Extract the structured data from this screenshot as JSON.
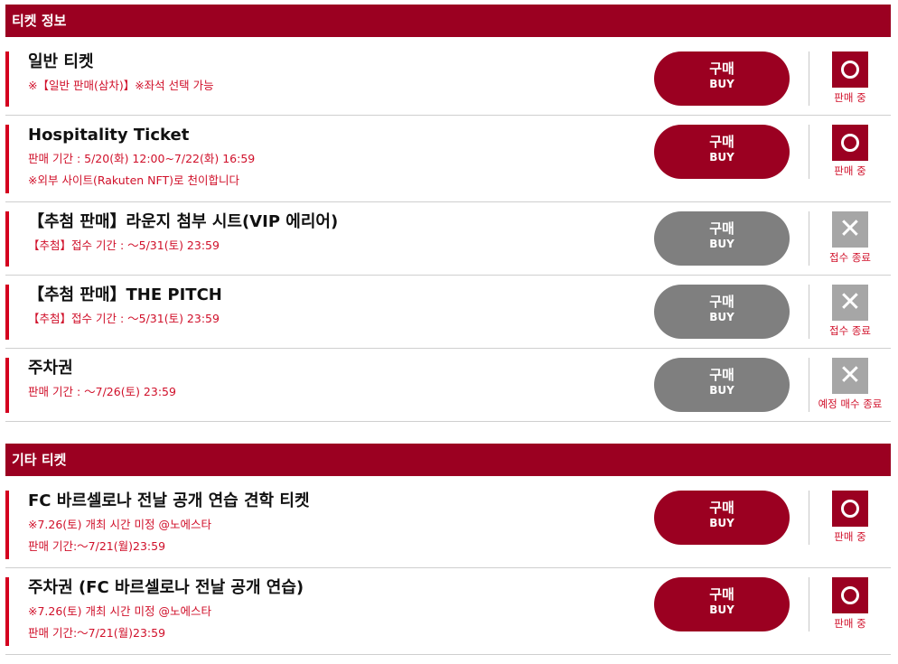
{
  "sections": [
    {
      "title": "티켓 정보"
    },
    {
      "title": "기타 티켓"
    }
  ],
  "buy": {
    "ko": "구매",
    "en": "BUY"
  },
  "rows": [
    {
      "title": "일반 티켓",
      "notes": [
        "※【일반 판매(삼차)】※좌석 선택 가능"
      ],
      "status": "판매 중"
    },
    {
      "title": "Hospitality Ticket",
      "notes": [
        "판매 기간 : 5/20(화) 12:00~7/22(화) 16:59",
        "※외부 사이트(Rakuten NFT)로 천이합니다"
      ],
      "status": "판매 중"
    },
    {
      "title": "【추첨 판매】라운지 첨부 시트(VIP 에리어)",
      "notes": [
        "【추첨】접수 기간 : ～5/31(토) 23:59"
      ],
      "status": "접수 종료"
    },
    {
      "title": "【추첨 판매】THE PITCH",
      "notes": [
        "【추첨】접수 기간 : ～5/31(토) 23:59"
      ],
      "status": "접수 종료"
    },
    {
      "title": "주차권",
      "notes": [
        "판매 기간 : ～7/26(토) 23:59"
      ],
      "status": "예정 매수 종료"
    },
    {
      "title": "FC 바르셀로나 전날 공개 연습 견학 티켓",
      "notes": [
        "※7.26(토) 개최 시간 미정 @노에스타",
        "판매 기간:～7/21(월)23:59"
      ],
      "status": "판매 중"
    },
    {
      "title": "주차권 (FC 바르셀로나 전날 공개 연습)",
      "notes": [
        "※7.26(토) 개최 시간 미정 @노에스타",
        "판매 기간:～7/21(월)23:59"
      ],
      "status": "판매 중"
    }
  ],
  "colors": {
    "brand": "#9b0021",
    "accent_red": "#d0102a",
    "disabled": "#7f7f7f",
    "closed": "#a6a6a6"
  }
}
